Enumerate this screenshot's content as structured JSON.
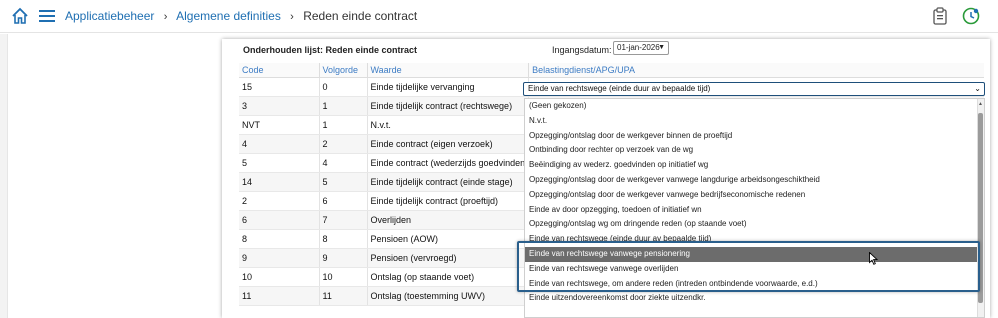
{
  "breadcrumb": {
    "items": [
      "Applicatiebeheer",
      "Algemene definities"
    ],
    "current": "Reden einde contract",
    "separator": "›"
  },
  "icons": {
    "home": "home-icon",
    "menu": "hamburger-menu-icon",
    "clipboard": "clipboard-icon",
    "user_clock": "user-clock-icon",
    "cursor": "mouse-pointer-icon"
  },
  "colors": {
    "accent": "#1f6fb2",
    "header_text": "#3d7cc4",
    "highlight": "#6c6c6c",
    "focus_border": "#2a5f8c"
  },
  "card": {
    "title": "Onderhouden lijst: Reden einde contract",
    "date_label": "Ingangsdatum:",
    "date_value": "01-jan-2026"
  },
  "table": {
    "headers": [
      "Code",
      "Volgorde",
      "Waarde",
      "Belastingdienst/APG/UPA"
    ],
    "rows": [
      {
        "code": "15",
        "volgorde": "0",
        "waarde": "Einde tijdelijke vervanging"
      },
      {
        "code": "3",
        "volgorde": "1",
        "waarde": "Einde tijdelijk contract (rechtswege)"
      },
      {
        "code": "NVT",
        "volgorde": "1",
        "waarde": "N.v.t."
      },
      {
        "code": "4",
        "volgorde": "2",
        "waarde": "Einde contract (eigen verzoek)"
      },
      {
        "code": "5",
        "volgorde": "4",
        "waarde": "Einde contract (wederzijds goedvinden)"
      },
      {
        "code": "14",
        "volgorde": "5",
        "waarde": "Einde tijdelijk contract (einde stage)"
      },
      {
        "code": "2",
        "volgorde": "6",
        "waarde": "Einde tijdelijk contract (proeftijd)"
      },
      {
        "code": "6",
        "volgorde": "7",
        "waarde": "Overlijden"
      },
      {
        "code": "8",
        "volgorde": "8",
        "waarde": "Pensioen (AOW)"
      },
      {
        "code": "9",
        "volgorde": "9",
        "waarde": "Pensioen (vervroegd)"
      },
      {
        "code": "10",
        "volgorde": "10",
        "waarde": "Ontslag (op staande voet)"
      },
      {
        "code": "11",
        "volgorde": "11",
        "waarde": "Ontslag (toestemming UWV)"
      }
    ]
  },
  "row_select": {
    "value": "Einde van rechtswege (einde duur av bepaalde tijd)"
  },
  "dropdown": {
    "options": [
      "(Geen gekozen)",
      "N.v.t.",
      "Opzegging/ontslag door de werkgever binnen de proeftijd",
      "Ontbinding door rechter op verzoek van de wg",
      "Beëindiging av wederz. goedvinden op initiatief wg",
      "Opzegging/ontslag door de werkgever vanwege langdurige arbeidsongeschiktheid",
      "Opzegging/ontslag door de werkgever vanwege bedrijfseconomische redenen",
      "Einde av door opzegging, toedoen of initiatief wn",
      "Opzegging/ontslag wg om dringende reden (op staande voet)",
      "Einde van rechtswege (einde duur av bepaalde tijd)",
      "Einde van rechtswege vanwege pensionering",
      "Einde van rechtswege vanwege overlijden",
      "Einde van rechtswege, om andere reden (intreden ontbindende voorwaarde, e.d.)",
      "Einde uitzendovereenkomst door ziekte uitzendkr."
    ],
    "highlighted_index": 10
  }
}
